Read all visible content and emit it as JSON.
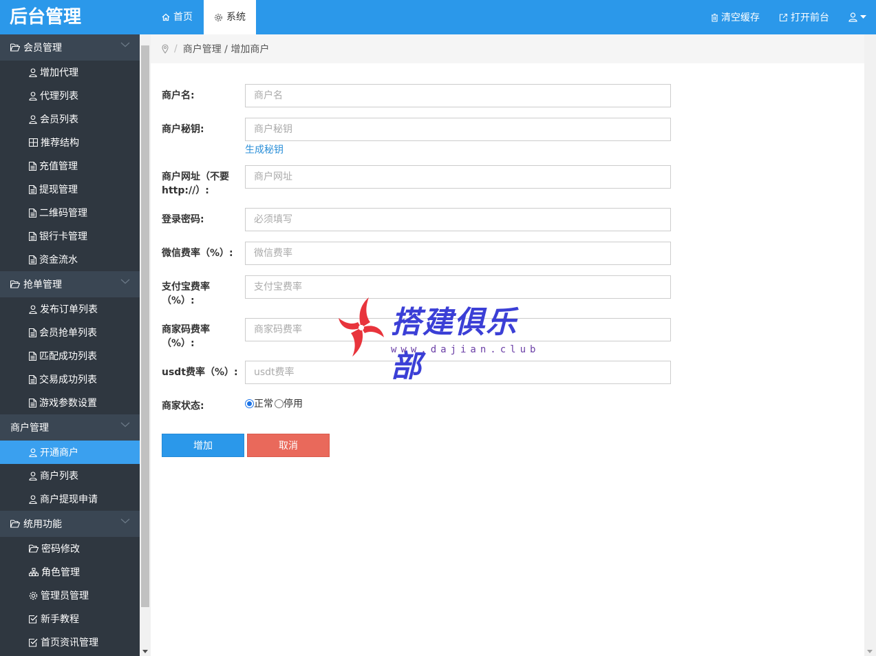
{
  "header": {
    "brand": "后台管理",
    "tabs": [
      {
        "label": "首页",
        "icon": "home-icon"
      },
      {
        "label": "系统",
        "icon": "gear-icon"
      }
    ],
    "actions": [
      {
        "label": "清空缓存",
        "icon": "trash-icon"
      },
      {
        "label": "打开前台",
        "icon": "external-link-icon"
      }
    ],
    "user_icon": "user-icon"
  },
  "sidebar": {
    "groups": [
      {
        "label": "会员管理",
        "icon": "folder-open-icon",
        "items": [
          {
            "label": "增加代理",
            "icon": "user-icon"
          },
          {
            "label": "代理列表",
            "icon": "user-icon"
          },
          {
            "label": "会员列表",
            "icon": "user-icon"
          },
          {
            "label": "推荐结构",
            "icon": "grid-icon"
          },
          {
            "label": "充值管理",
            "icon": "file-icon"
          },
          {
            "label": "提现管理",
            "icon": "file-icon"
          },
          {
            "label": "二维码管理",
            "icon": "file-icon"
          },
          {
            "label": "银行卡管理",
            "icon": "file-icon"
          },
          {
            "label": "资金流水",
            "icon": "file-icon"
          }
        ]
      },
      {
        "label": "抢单管理",
        "icon": "folder-open-icon",
        "items": [
          {
            "label": "发布订单列表",
            "icon": "user-icon"
          },
          {
            "label": "会员抢单列表",
            "icon": "file-icon"
          },
          {
            "label": "匹配成功列表",
            "icon": "file-icon"
          },
          {
            "label": "交易成功列表",
            "icon": "file-icon"
          },
          {
            "label": "游戏参数设置",
            "icon": "file-icon"
          }
        ]
      },
      {
        "label": "商户管理",
        "icon": "",
        "items": [
          {
            "label": "开通商户",
            "icon": "user-icon",
            "active": true
          },
          {
            "label": "商户列表",
            "icon": "user-icon"
          },
          {
            "label": "商户提现申请",
            "icon": "user-icon"
          }
        ]
      },
      {
        "label": "统用功能",
        "icon": "folder-open-icon",
        "items": [
          {
            "label": "密码修改",
            "icon": "folder-open-icon"
          },
          {
            "label": "角色管理",
            "icon": "sitemap-icon"
          },
          {
            "label": "管理员管理",
            "icon": "gear-icon"
          },
          {
            "label": "新手教程",
            "icon": "check-square-icon"
          },
          {
            "label": "首页资讯管理",
            "icon": "check-square-icon"
          }
        ]
      }
    ]
  },
  "breadcrumb": {
    "icon": "location-icon",
    "separator": "/",
    "path": "商户管理 / 增加商户"
  },
  "form": {
    "merchant_name": {
      "label": "商户名:",
      "placeholder": "商户名",
      "value": ""
    },
    "merchant_key": {
      "label": "商户秘钥:",
      "placeholder": "商户秘钥",
      "value": "",
      "link": "生成秘钥"
    },
    "merchant_url": {
      "label_line1": "商户网址（不要",
      "label_line2": "http://）:",
      "placeholder": "商户网址",
      "value": ""
    },
    "login_password": {
      "label": "登录密码:",
      "placeholder": "必须填写",
      "value": ""
    },
    "wechat_rate": {
      "label": "微信费率（%）:",
      "placeholder": "微信费率",
      "value": ""
    },
    "alipay_rate": {
      "label_line1": "支付宝费率",
      "label_line2": "（%）:",
      "placeholder": "支付宝费率",
      "value": ""
    },
    "merchant_code_rate": {
      "label_line1": "商家码费率",
      "label_line2": "（%）:",
      "placeholder": "商家码费率",
      "value": ""
    },
    "usdt_rate": {
      "label": "usdt费率（%）:",
      "placeholder": "usdt费率",
      "value": ""
    },
    "status": {
      "label": "商家状态:",
      "options": [
        "正常",
        "停用"
      ],
      "selected": "正常"
    },
    "submit_label": "增加",
    "cancel_label": "取消"
  },
  "watermark": {
    "text": "搭建俱乐部",
    "url": "www.dajian.club"
  },
  "colors": {
    "primary": "#2b98ea",
    "danger": "#e9695b",
    "sidebar_bg": "#2f3740",
    "sidebar_group_bg": "#3a4653",
    "active_item": "#3aa0ef"
  }
}
